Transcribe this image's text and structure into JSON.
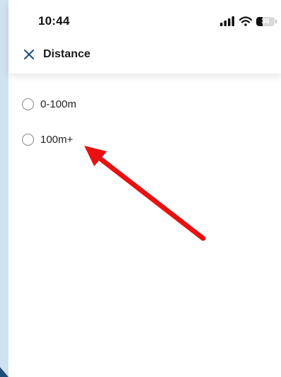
{
  "status_bar": {
    "time": "10:44",
    "battery": "36",
    "battery_level": 0.36,
    "icons": [
      "signal-icon",
      "wifi-icon",
      "battery-icon"
    ]
  },
  "header": {
    "close_icon": "close-icon",
    "title": "Distance"
  },
  "options": [
    {
      "label": "0-100m",
      "selected": false
    },
    {
      "label": "100m+",
      "selected": false
    }
  ],
  "annotation": {
    "icon": "arrow-icon",
    "color": "#e81010"
  },
  "colors": {
    "accent": "#1f4e79",
    "background": "#cfe2f1"
  }
}
